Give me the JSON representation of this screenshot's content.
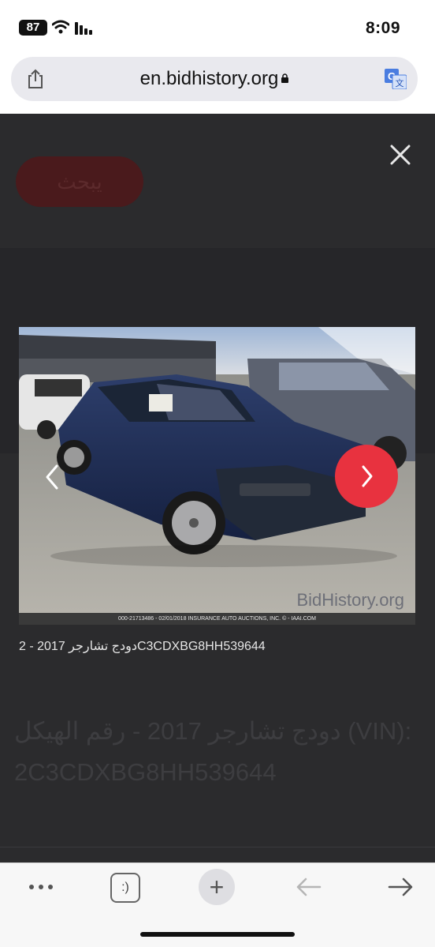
{
  "status_bar": {
    "battery": "87",
    "time": "8:09"
  },
  "browser": {
    "url": "en.bidhistory.org"
  },
  "page": {
    "search_label": "يبحث",
    "background_title": "دودج تشارجر 2017 - رقم الهيكل (VIN): 2C3CDXBG8HH539644"
  },
  "gallery": {
    "caption": "2 - 2017 دودج تشارجرC3CDXBG8HH539644",
    "watermark": "BidHistory.org",
    "image_footer": "000-21713486 - 02/01/2018 INSURANCE AUTO AUCTIONS, INC. © - IAAI.COM",
    "accent_color": "#e8323f"
  },
  "toolbar": {
    "more": "•••",
    "reader": ":)",
    "new_tab": "+"
  }
}
